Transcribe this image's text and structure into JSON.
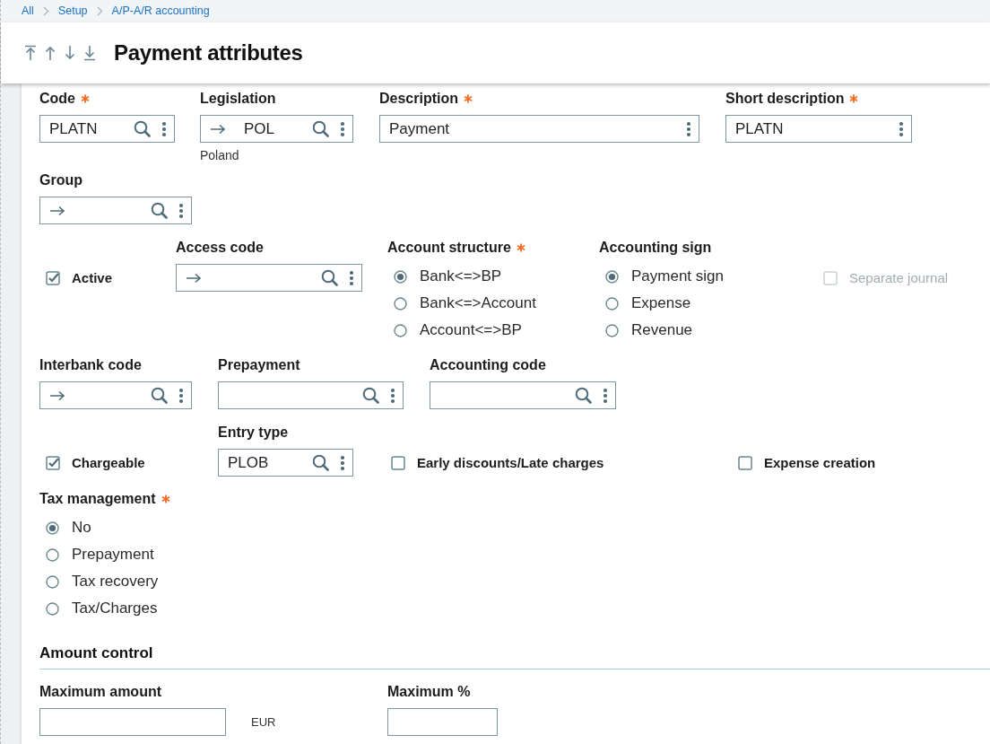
{
  "breadcrumb": [
    {
      "label": "All"
    },
    {
      "label": "Setup"
    },
    {
      "label": "A/P-A/R accounting"
    }
  ],
  "title": "Payment attributes",
  "rows": [
    {
      "items": [
        {
          "kind": "field",
          "label": "Code",
          "required": true,
          "value": "PLATN",
          "link_arrow": false,
          "search_button": true,
          "menu_button": true
        },
        {
          "kind": "field",
          "label": "Legislation",
          "required": false,
          "value": "POL",
          "link_arrow": true,
          "search_button": true,
          "menu_button": true,
          "note": "Poland"
        },
        {
          "kind": "field",
          "label": "Description",
          "required": true,
          "value": "Payment",
          "link_arrow": false,
          "search_button": false,
          "menu_button": true
        },
        {
          "kind": "field",
          "label": "Short description",
          "required": true,
          "value": "PLATN",
          "link_arrow": false,
          "search_button": false,
          "menu_button": true
        }
      ]
    },
    {
      "items": [
        {
          "kind": "field",
          "label": "Group",
          "required": false,
          "value": "",
          "link_arrow": true,
          "search_button": true,
          "menu_button": true
        }
      ]
    },
    {
      "items": [
        {
          "kind": "checkbox",
          "label": "Active",
          "checked": true,
          "disabled": false
        },
        {
          "kind": "field",
          "label": "Access code",
          "required": false,
          "value": "",
          "link_arrow": true,
          "search_button": true,
          "menu_button": true
        },
        {
          "kind": "radio_group",
          "label": "Account structure",
          "required": true,
          "options": [
            {
              "label": "Bank<=>BP",
              "selected": true
            },
            {
              "label": "Bank<=>Account",
              "selected": false
            },
            {
              "label": "Account<=>BP",
              "selected": false
            }
          ]
        },
        {
          "kind": "radio_group",
          "label": "Accounting sign",
          "required": false,
          "options": [
            {
              "label": "Payment sign",
              "selected": true
            },
            {
              "label": "Expense",
              "selected": false
            },
            {
              "label": "Revenue",
              "selected": false
            }
          ]
        },
        {
          "kind": "checkbox",
          "label": "Separate journal",
          "checked": false,
          "disabled": true
        }
      ]
    },
    {
      "items": [
        {
          "kind": "field",
          "label": "Interbank code",
          "required": false,
          "value": "",
          "link_arrow": true,
          "search_button": true,
          "menu_button": true
        },
        {
          "kind": "field",
          "label": "Prepayment",
          "required": false,
          "value": "",
          "link_arrow": false,
          "search_button": true,
          "menu_button": true
        },
        {
          "kind": "field",
          "label": "Accounting code",
          "required": false,
          "value": "",
          "link_arrow": false,
          "search_button": true,
          "menu_button": true
        }
      ]
    },
    {
      "items": [
        {
          "kind": "checkbox",
          "label": "Chargeable",
          "checked": true,
          "disabled": false
        },
        {
          "kind": "field",
          "label": "Entry type",
          "required": false,
          "value": "PLOB",
          "link_arrow": false,
          "search_button": true,
          "menu_button": true
        },
        {
          "kind": "checkbox",
          "label": "Early discounts/Late charges",
          "checked": false,
          "disabled": false
        },
        {
          "kind": "checkbox",
          "label": "Expense creation",
          "checked": false,
          "disabled": false
        }
      ]
    },
    {
      "items": [
        {
          "kind": "radio_group",
          "label": "Tax management",
          "required": true,
          "options": [
            {
              "label": "No",
              "selected": true
            },
            {
              "label": "Prepayment",
              "selected": false
            },
            {
              "label": "Tax recovery",
              "selected": false
            },
            {
              "label": "Tax/Charges",
              "selected": false
            }
          ]
        }
      ]
    },
    {
      "section_heading": "Amount control"
    },
    {
      "items": [
        {
          "kind": "field",
          "label": "Maximum amount",
          "required": false,
          "value": "",
          "link_arrow": false,
          "search_button": false,
          "menu_button": false,
          "unit": "EUR"
        },
        {
          "kind": "field",
          "label": "Maximum %",
          "required": false,
          "value": "",
          "link_arrow": false,
          "search_button": false,
          "menu_button": false
        }
      ]
    }
  ]
}
